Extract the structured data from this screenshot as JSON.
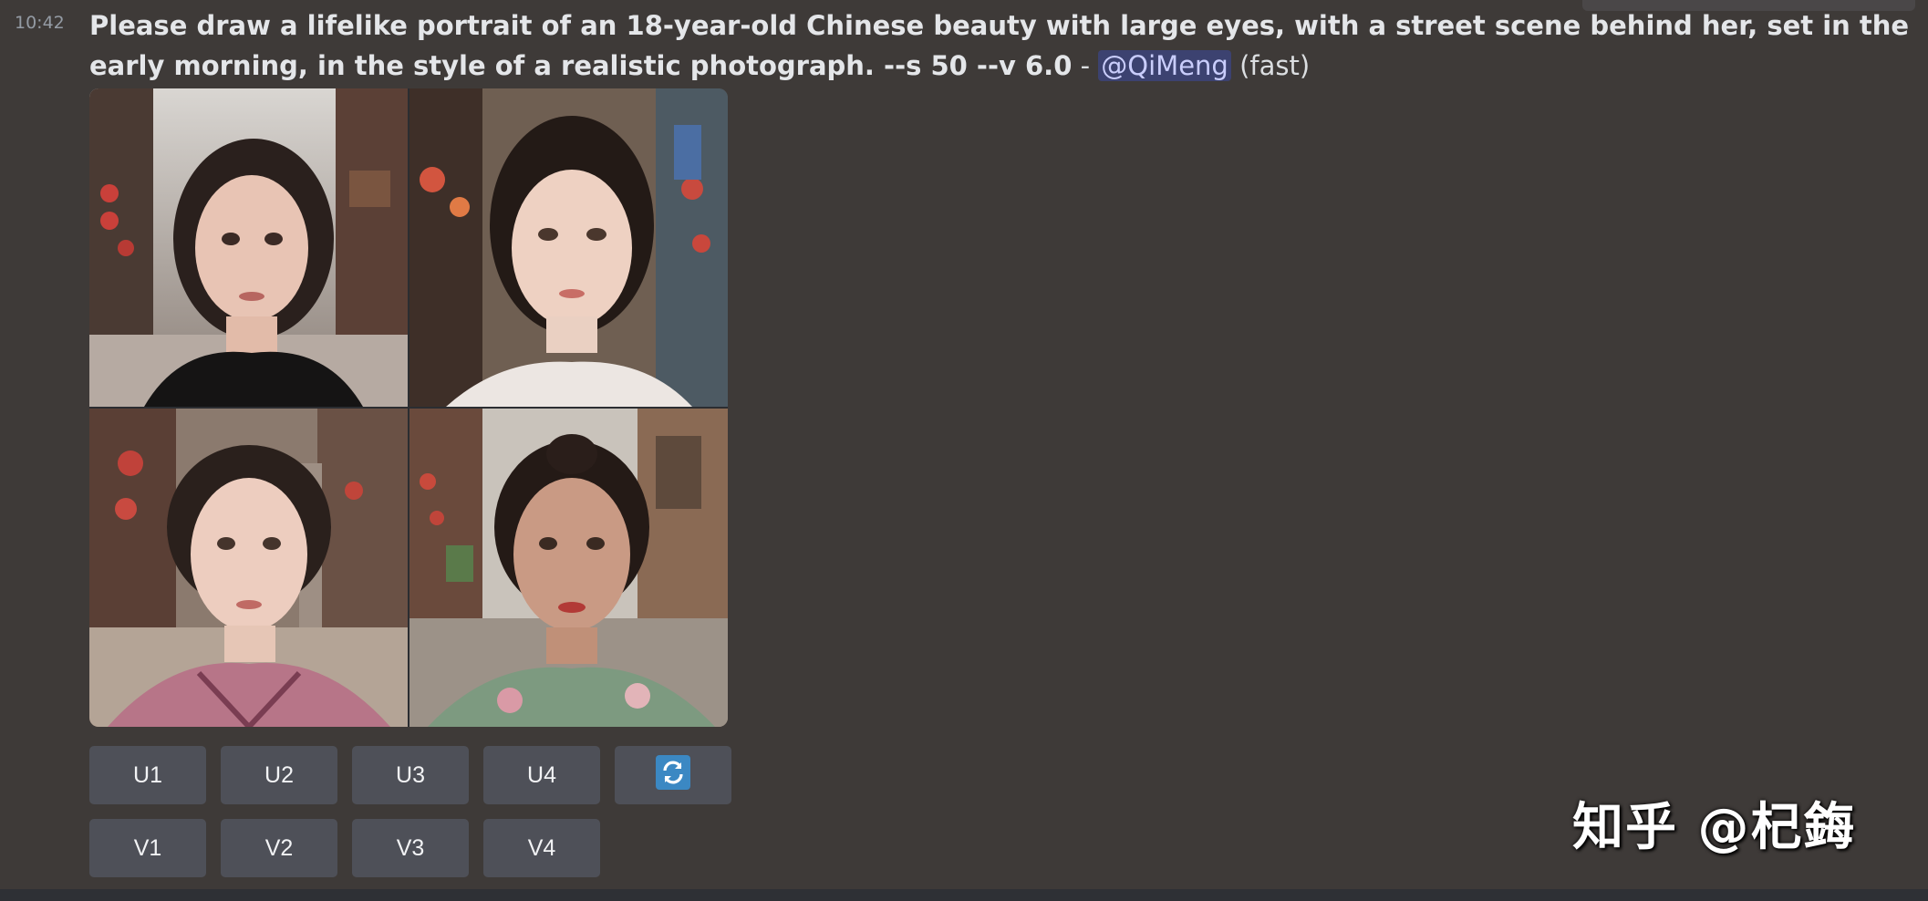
{
  "message": {
    "timestamp": "10:42",
    "prompt": "Please draw a lifelike portrait of an 18-year-old Chinese beauty with large eyes, with a street scene behind her, set in the early morning, in the style of a realistic photograph. --s 50 --v 6.0",
    "separator": "-",
    "mention": "@QiMeng",
    "speed": "(fast)"
  },
  "buttons": {
    "upscale": [
      "U1",
      "U2",
      "U3",
      "U4"
    ],
    "variation": [
      "V1",
      "V2",
      "V3",
      "V4"
    ],
    "reroll_icon": "refresh-icon"
  },
  "watermark": "知乎 @杞鋂",
  "colors": {
    "background": "#3e3a38",
    "button": "#4e5058",
    "mention_bg": "#3c4270",
    "mention_text": "#c9cdfb",
    "reroll_accent": "#3b88c3"
  }
}
